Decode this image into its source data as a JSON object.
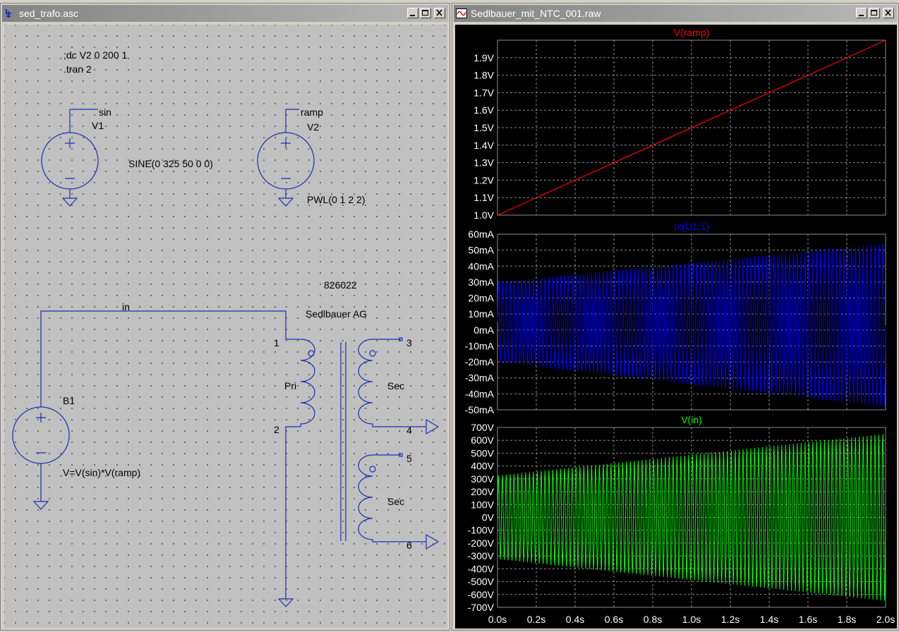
{
  "schematic": {
    "title": "sed_trafo.asc",
    "directive1": ";dc V2 0 200 1",
    "directive2": ".tran 2",
    "v1": {
      "net": "sin",
      "name": "V1",
      "value": "SINE(0 325 50 0 0)"
    },
    "v2": {
      "net": "ramp",
      "name": "V2",
      "value": "PWL(0 1 2 2)"
    },
    "b1": {
      "name": "B1",
      "value": "V=V(sin)*V(ramp)"
    },
    "net_in": "in",
    "transformer": {
      "part": "826022",
      "maker": "Sedlbauer AG",
      "pri": "Pri",
      "sec1": "Sec",
      "sec2": "Sec",
      "pins": [
        "1",
        "2",
        "3",
        "4",
        "5",
        "6"
      ]
    },
    "colors": {
      "wire": "#1c2fb0",
      "text": "#000000"
    }
  },
  "waveform": {
    "title": "Sedlbauer_mit_NTC_001.raw",
    "x_ticks": [
      "0.0s",
      "0.2s",
      "0.4s",
      "0.6s",
      "0.8s",
      "1.0s",
      "1.2s",
      "1.4s",
      "1.6s",
      "1.8s",
      "2.0s"
    ],
    "colors": {
      "ramp": "#ff0000",
      "ix": "#0000ff",
      "vin": "#00ff00",
      "grid": "#8c8c8c",
      "label": "#ffffff"
    }
  },
  "chart_data": [
    {
      "type": "line",
      "title": "V(ramp)",
      "x": [
        0.0,
        2.0
      ],
      "y": [
        1.0,
        2.0
      ],
      "xlim": [
        0.0,
        2.0
      ],
      "ylim": [
        1.0,
        2.0
      ],
      "y_ticks": [
        "1.0V",
        "1.1V",
        "1.2V",
        "1.3V",
        "1.4V",
        "1.5V",
        "1.6V",
        "1.7V",
        "1.8V",
        "1.9V"
      ],
      "grid": true
    },
    {
      "type": "line",
      "title": "Ix(U1:1)",
      "frequency_hz": 50,
      "envelope_x": [
        0.0,
        2.0
      ],
      "envelope_max": [
        30,
        54
      ],
      "envelope_min": [
        -20,
        -48
      ],
      "ylim": [
        -50,
        60
      ],
      "y_ticks": [
        "60mA",
        "50mA",
        "40mA",
        "30mA",
        "20mA",
        "10mA",
        "0mA",
        "-10mA",
        "-20mA",
        "-30mA",
        "-40mA",
        "-50mA"
      ],
      "grid": true
    },
    {
      "type": "line",
      "title": "V(in)",
      "frequency_hz": 50,
      "envelope_x": [
        0.0,
        2.0
      ],
      "envelope_max": [
        325,
        650
      ],
      "envelope_min": [
        -325,
        -650
      ],
      "ylim": [
        -700,
        700
      ],
      "y_ticks": [
        "700V",
        "600V",
        "500V",
        "400V",
        "300V",
        "200V",
        "100V",
        "0V",
        "-100V",
        "-200V",
        "-300V",
        "-400V",
        "-500V",
        "-600V",
        "-700V"
      ],
      "grid": true
    }
  ]
}
